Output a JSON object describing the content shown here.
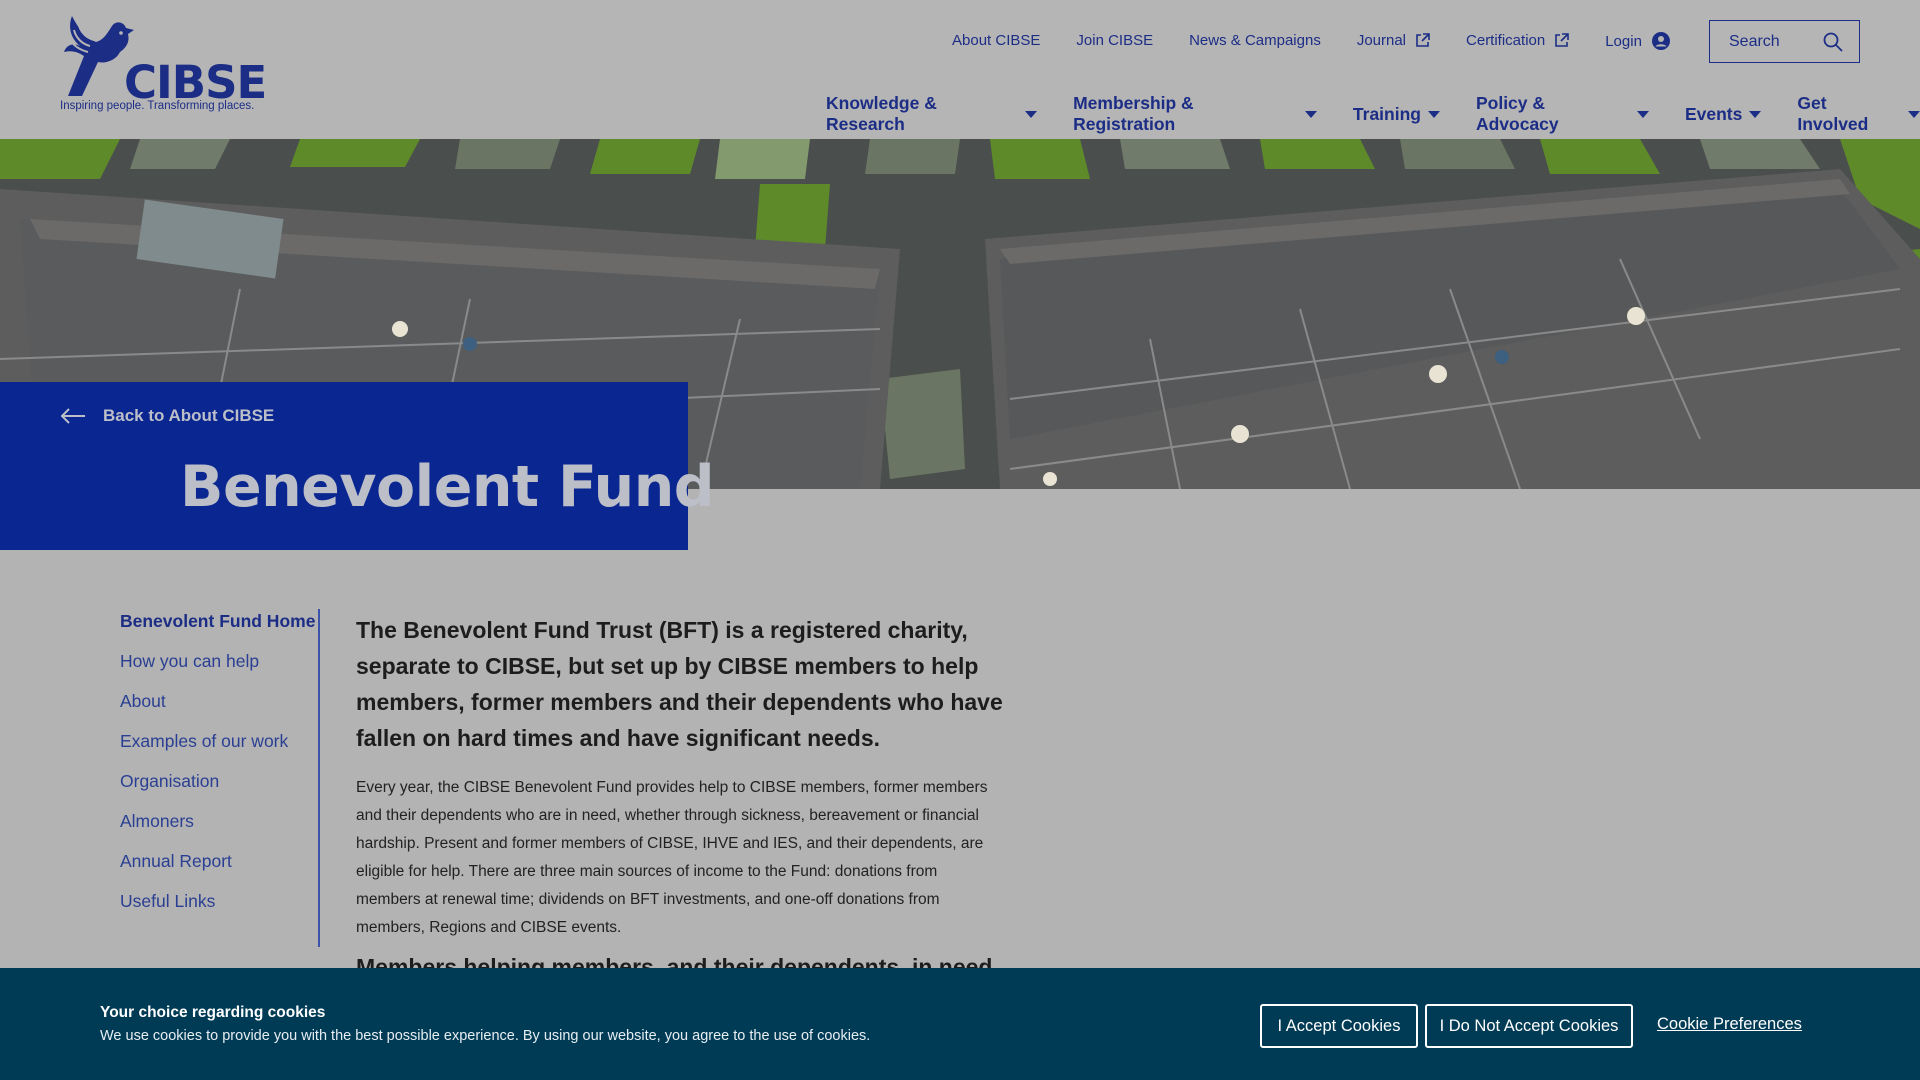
{
  "header": {
    "logo_text": "CIBSE",
    "tagline": "Inspiring people. Transforming places.",
    "top_links": [
      {
        "label": "About CIBSE",
        "external": false
      },
      {
        "label": "Join CIBSE",
        "external": false
      },
      {
        "label": "News & Campaigns",
        "external": false
      },
      {
        "label": "Journal",
        "external": true
      },
      {
        "label": "Certification",
        "external": true
      }
    ],
    "login_label": "Login",
    "search_placeholder": "Search",
    "main_nav": [
      "Knowledge & Research",
      "Membership & Registration",
      "Training",
      "Policy & Advocacy",
      "Events",
      "Get Involved"
    ]
  },
  "hero": {
    "back_label": "Back to About CIBSE",
    "title": "Benevolent Fund"
  },
  "sidebar": {
    "items": [
      {
        "label": "Benevolent Fund Home",
        "active": true
      },
      {
        "label": "How you can help",
        "active": false
      },
      {
        "label": "About",
        "active": false
      },
      {
        "label": "Examples of our work",
        "active": false
      },
      {
        "label": "Organisation",
        "active": false
      },
      {
        "label": "Almoners",
        "active": false
      },
      {
        "label": "Annual Report",
        "active": false
      },
      {
        "label": "Useful Links",
        "active": false
      }
    ]
  },
  "article": {
    "lead": "The Benevolent Fund Trust (BFT) is a registered charity, separate to CIBSE, but set up by CIBSE members to help members, former members and their dependents who have fallen on hard times and have significant needs.",
    "body": "Every year, the CIBSE Benevolent Fund provides help to CIBSE members, former members and their dependents who are in need, whether through sickness, bereavement or financial hardship. Present and former members of CIBSE, IHVE and IES, and their dependents, are eligible for help. There are three main sources of income to the Fund: donations from members at renewal time; dividends on BFT investments, and one-off donations from members, Regions and CIBSE events.",
    "subheading": "Members helping members, and their dependents, in need"
  },
  "cookie_banner": {
    "title": "Your choice regarding cookies",
    "text": "We use cookies to provide you with the best possible experience. By using our website, you agree to the use of cookies.",
    "accept_label": "I Accept Cookies",
    "decline_label": "I Do Not Accept Cookies",
    "preferences_label": "Cookie Preferences"
  },
  "colors": {
    "brand_blue": "#1c2d86",
    "title_block": "#0a2791",
    "cookie_bg": "#003b56"
  }
}
